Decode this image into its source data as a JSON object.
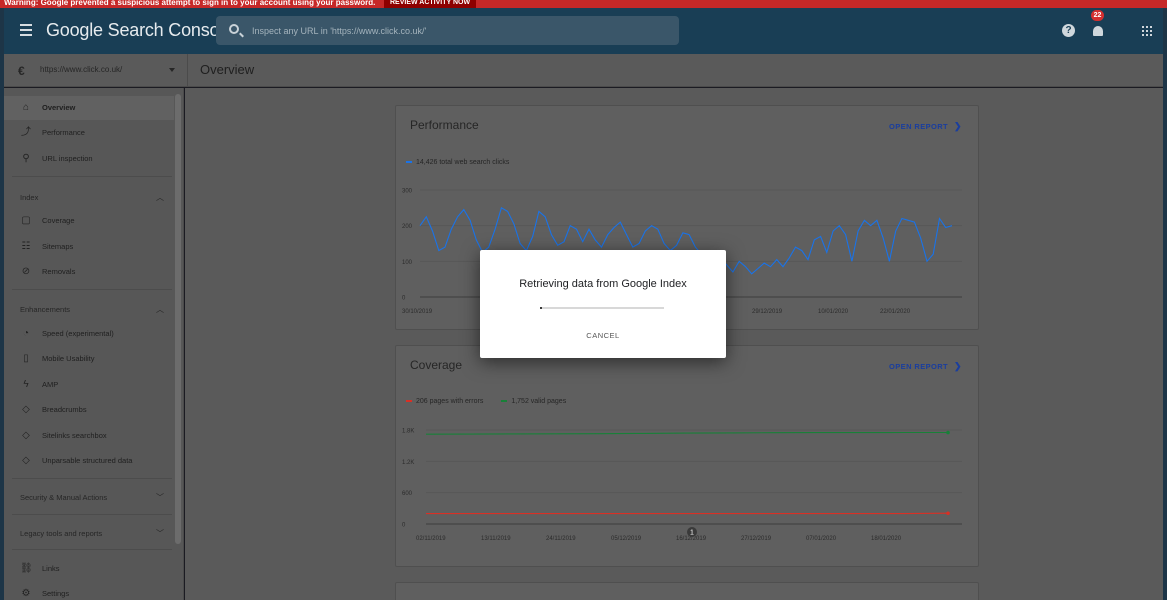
{
  "warning": {
    "text": "Warning: Google prevented a suspicious attempt to sign in to your account using your password.",
    "action_label": "REVIEW ACTIVITY NOW"
  },
  "header": {
    "product_name": "Google Search Console",
    "search_placeholder": "Inspect any URL in 'https://www.click.co.uk/'",
    "notification_count": "22",
    "icons": [
      "menu-icon",
      "search-icon",
      "help-icon",
      "bell-icon",
      "apps-icon"
    ]
  },
  "property": {
    "url": "https://www.click.co.uk/"
  },
  "page": {
    "title": "Overview"
  },
  "sidebar": {
    "items": [
      {
        "label": "Overview",
        "icon": "home-icon"
      },
      {
        "label": "Performance",
        "icon": "trending-icon"
      },
      {
        "label": "URL inspection",
        "icon": "search-icon"
      }
    ],
    "index_label": "Index",
    "index_items": [
      {
        "label": "Coverage",
        "icon": "document-icon"
      },
      {
        "label": "Sitemaps",
        "icon": "sitemap-icon"
      },
      {
        "label": "Removals",
        "icon": "removals-icon"
      }
    ],
    "enhancements_label": "Enhancements",
    "enhancement_items": [
      {
        "label": "Speed (experimental)",
        "icon": "speed-icon"
      },
      {
        "label": "Mobile Usability",
        "icon": "mobile-icon"
      },
      {
        "label": "AMP",
        "icon": "amp-icon"
      },
      {
        "label": "Breadcrumbs",
        "icon": "diamond-icon"
      },
      {
        "label": "Sitelinks searchbox",
        "icon": "diamond-icon"
      },
      {
        "label": "Unparsable structured data",
        "icon": "diamond-icon"
      }
    ],
    "security_label": "Security & Manual Actions",
    "legacy_label": "Legacy tools and reports",
    "bottom_items": [
      {
        "label": "Links",
        "icon": "links-icon"
      },
      {
        "label": "Settings",
        "icon": "settings-icon"
      }
    ]
  },
  "performance": {
    "title": "Performance",
    "open_report": "OPEN REPORT",
    "legend": "14,426 total web search clicks",
    "color": "#1a73e8"
  },
  "coverage": {
    "title": "Coverage",
    "open_report": "OPEN REPORT",
    "legend_errors": "206 pages with errors",
    "legend_valid": "1,752 valid pages",
    "error_color": "#d93025",
    "valid_color": "#188038",
    "annotation": "1"
  },
  "dialog": {
    "title": "Retrieving data from Google Index",
    "cancel": "CANCEL",
    "progress": 0.02
  },
  "chart_data": [
    {
      "type": "line",
      "title": "Performance",
      "xlabel": "",
      "ylabel": "",
      "ylim": [
        0,
        300
      ],
      "y_ticks": [
        "0",
        "100",
        "200",
        "300"
      ],
      "x_ticks": [
        "30/10/2019",
        "29/12/2019",
        "10/01/2020",
        "22/01/2020"
      ],
      "grid": true,
      "series": [
        {
          "name": "14,426 total web search clicks",
          "color": "#1a73e8",
          "values": [
            200,
            225,
            185,
            130,
            140,
            190,
            225,
            245,
            215,
            160,
            125,
            140,
            190,
            250,
            240,
            205,
            150,
            130,
            170,
            240,
            225,
            175,
            145,
            155,
            200,
            190,
            155,
            190,
            160,
            140,
            175,
            195,
            210,
            175,
            140,
            150,
            185,
            200,
            190,
            150,
            130,
            145,
            180,
            175,
            140,
            120,
            105,
            95,
            110,
            90,
            70,
            100,
            85,
            65,
            80,
            95,
            85,
            105,
            85,
            110,
            140,
            130,
            105,
            160,
            170,
            125,
            185,
            200,
            175,
            100,
            185,
            215,
            200,
            215,
            165,
            100,
            185,
            220,
            215,
            210,
            165,
            100,
            120,
            220,
            195,
            200
          ]
        }
      ]
    },
    {
      "type": "line",
      "title": "Coverage",
      "xlabel": "",
      "ylabel": "",
      "ylim": [
        0,
        1800
      ],
      "y_ticks": [
        "0",
        "600",
        "1.2K",
        "1.8K"
      ],
      "x_ticks": [
        "02/11/2019",
        "13/11/2019",
        "24/11/2019",
        "05/12/2019",
        "16/12/2019",
        "27/12/2019",
        "07/01/2020",
        "18/01/2020"
      ],
      "grid": true,
      "series": [
        {
          "name": "206 pages with errors",
          "color": "#d93025",
          "values": [
            200,
            200,
            200,
            200,
            200,
            200,
            200,
            200,
            200,
            200,
            200,
            200,
            206
          ]
        },
        {
          "name": "1,752 valid pages",
          "color": "#188038",
          "values": [
            1720,
            1722,
            1725,
            1728,
            1730,
            1735,
            1740,
            1745,
            1748,
            1750,
            1750,
            1752,
            1752
          ]
        }
      ]
    }
  ]
}
